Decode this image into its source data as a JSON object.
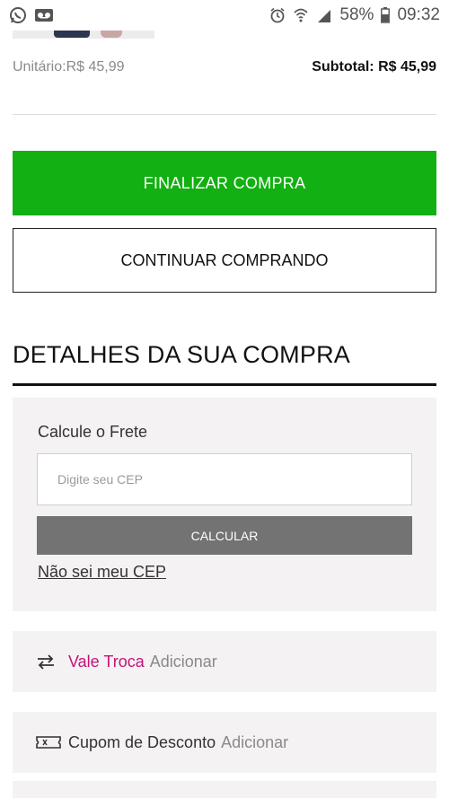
{
  "status_bar": {
    "battery_percent": "58%",
    "time": "09:32",
    "left_icons": [
      "whatsapp-icon",
      "voicemail-icon"
    ],
    "right_icons": [
      "alarm-icon",
      "wifi-icon",
      "signal-icon",
      "battery-icon"
    ]
  },
  "cart_item": {
    "unit_price": "Unitário:R$ 45,99",
    "subtotal": "Subtotal: R$ 45,99"
  },
  "actions": {
    "finalize_label": "FINALIZAR COMPRA",
    "continue_label": "CONTINUAR COMPRANDO"
  },
  "details": {
    "title": "DETALHES DA SUA COMPRA"
  },
  "shipping": {
    "label": "Calcule o Frete",
    "cep_placeholder": "Digite seu CEP",
    "cep_value": "",
    "calculate_label": "CALCULAR",
    "unknown_cep_link": "Não sei meu CEP"
  },
  "vale_troca": {
    "label": "Vale Troca",
    "action": "Adicionar",
    "icon": "swap-arrows-icon",
    "color": "#c4127a"
  },
  "coupon": {
    "label": "Cupom de Desconto",
    "action": "Adicionar",
    "icon": "ticket-icon"
  },
  "colors": {
    "finalize_green": "#12b012",
    "calculate_gray": "#737373",
    "panel_bg": "#f4f2f3"
  }
}
